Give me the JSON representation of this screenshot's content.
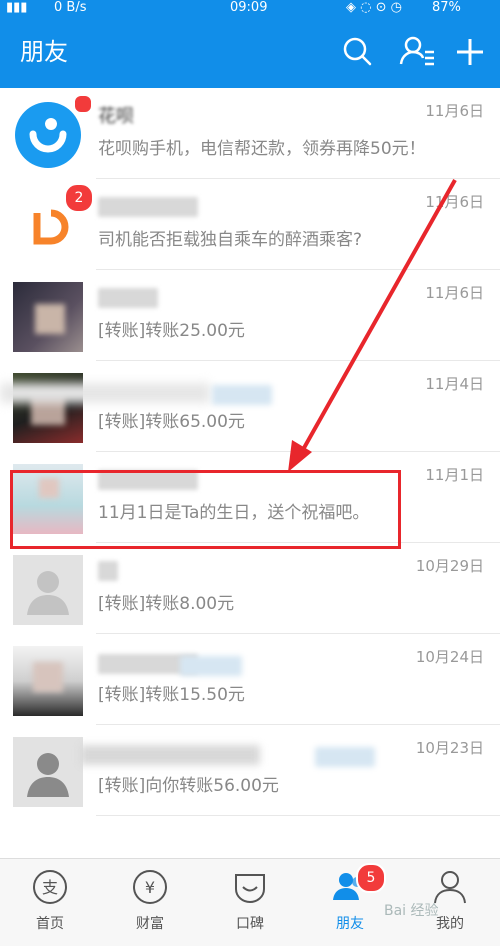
{
  "status_bar": {
    "speed": "0 B/s",
    "time": "09:09",
    "battery": "87%"
  },
  "header": {
    "title": "朋友"
  },
  "conversations": [
    {
      "name": "花呗",
      "date": "11月6日",
      "message": "花呗购手机，电信帮还款，领券再降50元！"
    },
    {
      "name": "",
      "date": "11月6日",
      "message": "司机能否拒载独自乘车的醉酒乘客?",
      "badge": "2"
    },
    {
      "name": "",
      "date": "11月6日",
      "message": "[转账]转账25.00元"
    },
    {
      "name": "",
      "date": "11月4日",
      "message": "[转账]转账65.00元"
    },
    {
      "name": "",
      "date": "11月1日",
      "message": "11月1日是Ta的生日，送个祝福吧。"
    },
    {
      "name": "",
      "date": "10月29日",
      "message": "[转账]转账8.00元"
    },
    {
      "name": "",
      "date": "10月24日",
      "message": "[转账]转账15.50元"
    },
    {
      "name": "",
      "date": "10月23日",
      "message": "[转账]向你转账56.00元"
    }
  ],
  "tabs": [
    {
      "label": "首页"
    },
    {
      "label": "财富"
    },
    {
      "label": "口碑"
    },
    {
      "label": "朋友",
      "badge": "5"
    },
    {
      "label": "我的"
    }
  ],
  "watermark": "Bai 经验",
  "colors": {
    "primary": "#118ee9",
    "badge": "#f23b3b",
    "highlight": "#e8262c"
  }
}
